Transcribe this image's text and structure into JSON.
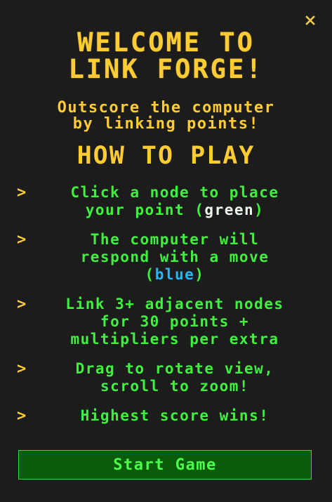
{
  "dialog": {
    "close_icon": "close-icon",
    "title": "WELCOME TO\nLINK FORGE!",
    "subtitle": "Outscore the computer\nby linking points!",
    "how_to_play": "HOW TO PLAY",
    "bullet": ">",
    "rules": [
      {
        "text": "Click a node to place\nyour point (",
        "highlight": "green",
        "suffix": ")"
      },
      {
        "text": "The computer will\nrespond with a move\n(",
        "highlight": "blue",
        "suffix": ")"
      },
      {
        "text": "Link 3+ adjacent nodes\nfor 30 points +\nmultipliers per extra"
      },
      {
        "text": "Drag to rotate view,\nscroll to zoom!"
      },
      {
        "text": "Highest score wins!"
      }
    ],
    "start_button": "Start Game"
  },
  "colors": {
    "background": "#1c1c1c",
    "title": "#ffcc33",
    "rule_text": "#3ef23e",
    "highlight_green": "#eaf5ea",
    "highlight_blue": "#29b6f6",
    "button_bg": "#0a5c0a",
    "button_text": "#4cff4c"
  }
}
